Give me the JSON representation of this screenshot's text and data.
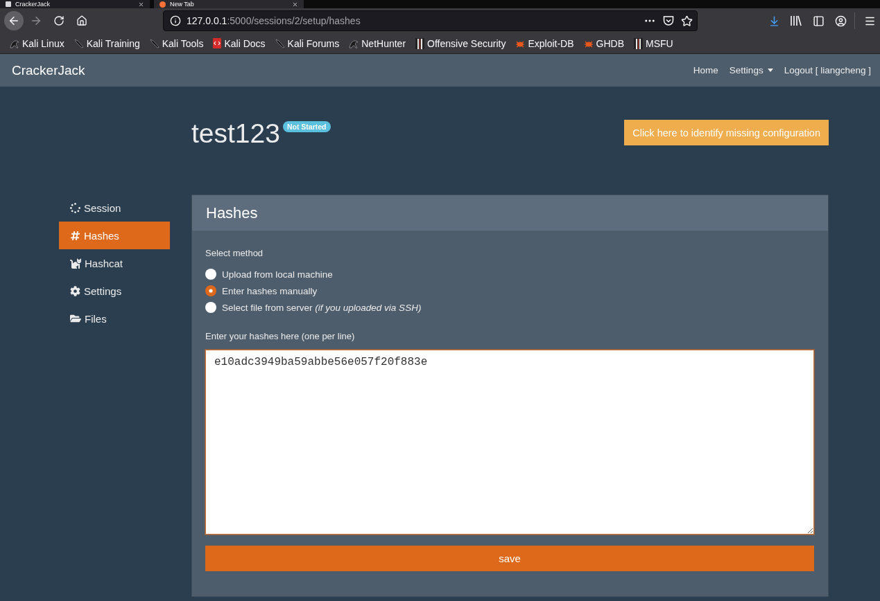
{
  "browser": {
    "tabs": [
      {
        "title": "CrackerJack",
        "kind": "page",
        "selected": true
      },
      {
        "title": "New Tab",
        "kind": "browser",
        "selected": false
      }
    ],
    "forward_disabled": true,
    "address": {
      "host": "127.0.0.1",
      "path": ":5000/sessions/2/setup/hashes"
    },
    "bookmarks": [
      {
        "label": "Kali Linux",
        "kind": "dragon"
      },
      {
        "label": "Kali Training",
        "kind": "blade"
      },
      {
        "label": "Kali Tools",
        "kind": "blade"
      },
      {
        "label": "Kali Docs",
        "kind": "book"
      },
      {
        "label": "Kali Forums",
        "kind": "blade"
      },
      {
        "label": "NetHunter",
        "kind": "dragon"
      },
      {
        "label": "Offensive Security",
        "kind": "stripes"
      },
      {
        "label": "Exploit-DB",
        "kind": "bug"
      },
      {
        "label": "GHDB",
        "kind": "bug"
      },
      {
        "label": "MSFU",
        "kind": "stripes"
      }
    ]
  },
  "navbar": {
    "brand": "CrackerJack",
    "links": [
      {
        "label": "Home",
        "kind": "link"
      },
      {
        "label": "Settings",
        "kind": "dropdown"
      },
      {
        "label": "Logout [ liangcheng ]",
        "kind": "link"
      }
    ]
  },
  "session": {
    "title": "test123",
    "status": "Not Started",
    "config_button": "Click here to identify missing configuration"
  },
  "sidebar": {
    "items": [
      {
        "label": "Session",
        "kind": "session",
        "selected": false
      },
      {
        "label": "Hashes",
        "kind": "hashes",
        "selected": true
      },
      {
        "label": "Hashcat",
        "kind": "hashcat",
        "selected": false
      },
      {
        "label": "Settings",
        "kind": "settings",
        "selected": false
      },
      {
        "label": "Files",
        "kind": "files",
        "selected": false
      }
    ]
  },
  "card": {
    "title": "Hashes",
    "method_label": "Select method",
    "methods": [
      {
        "label": "Upload from local machine",
        "selected": false
      },
      {
        "label": "Enter hashes manually",
        "selected": true
      },
      {
        "label": "Select file from server *(if you uploaded via SSH)*",
        "selected": false
      }
    ],
    "hashes_label": "Enter your hashes here (one per line)",
    "hashes_value": "e10adc3949ba59abbe56e057f20f883e",
    "save_button": "save"
  }
}
